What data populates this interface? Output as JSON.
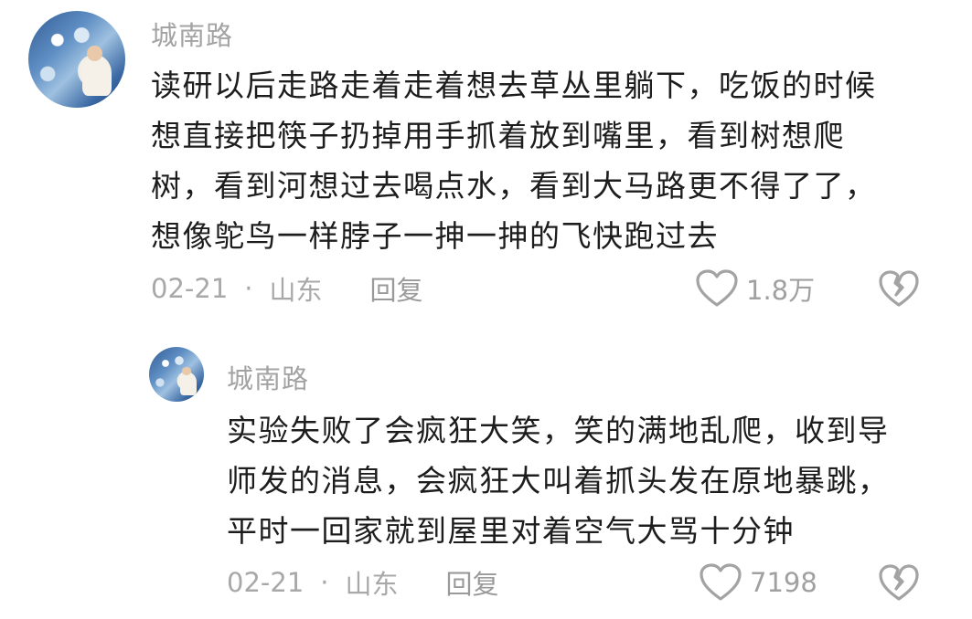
{
  "comments": [
    {
      "username": "城南路",
      "text": "读研以后走路走着走着想去草丛里躺下，吃饭的时候\n想直接把筷子扔掉用手抓着放到嘴里，看到树想爬\n树，看到河想过去喝点水，看到大马路更不得了了，\n想像鸵鸟一样脖子一抻一抻的飞快跑过去",
      "date": "02-21",
      "separator": "·",
      "location": "山东",
      "reply_label": "回复",
      "like_count": "1.8万"
    },
    {
      "username": "城南路",
      "text": "实验失败了会疯狂大笑，笑的满地乱爬，收到导\n师发的消息，会疯狂大叫着抓头发在原地暴跳，\n平时一回家就到屋里对着空气大骂十分钟",
      "date": "02-21",
      "separator": "·",
      "location": "山东",
      "reply_label": "回复",
      "like_count": "7198"
    }
  ],
  "icons": {
    "like": "heart-outline-icon",
    "dislike": "broken-heart-icon"
  },
  "colors": {
    "text": "#1d1d1d",
    "meta": "#a8a8a8",
    "background": "#ffffff"
  }
}
